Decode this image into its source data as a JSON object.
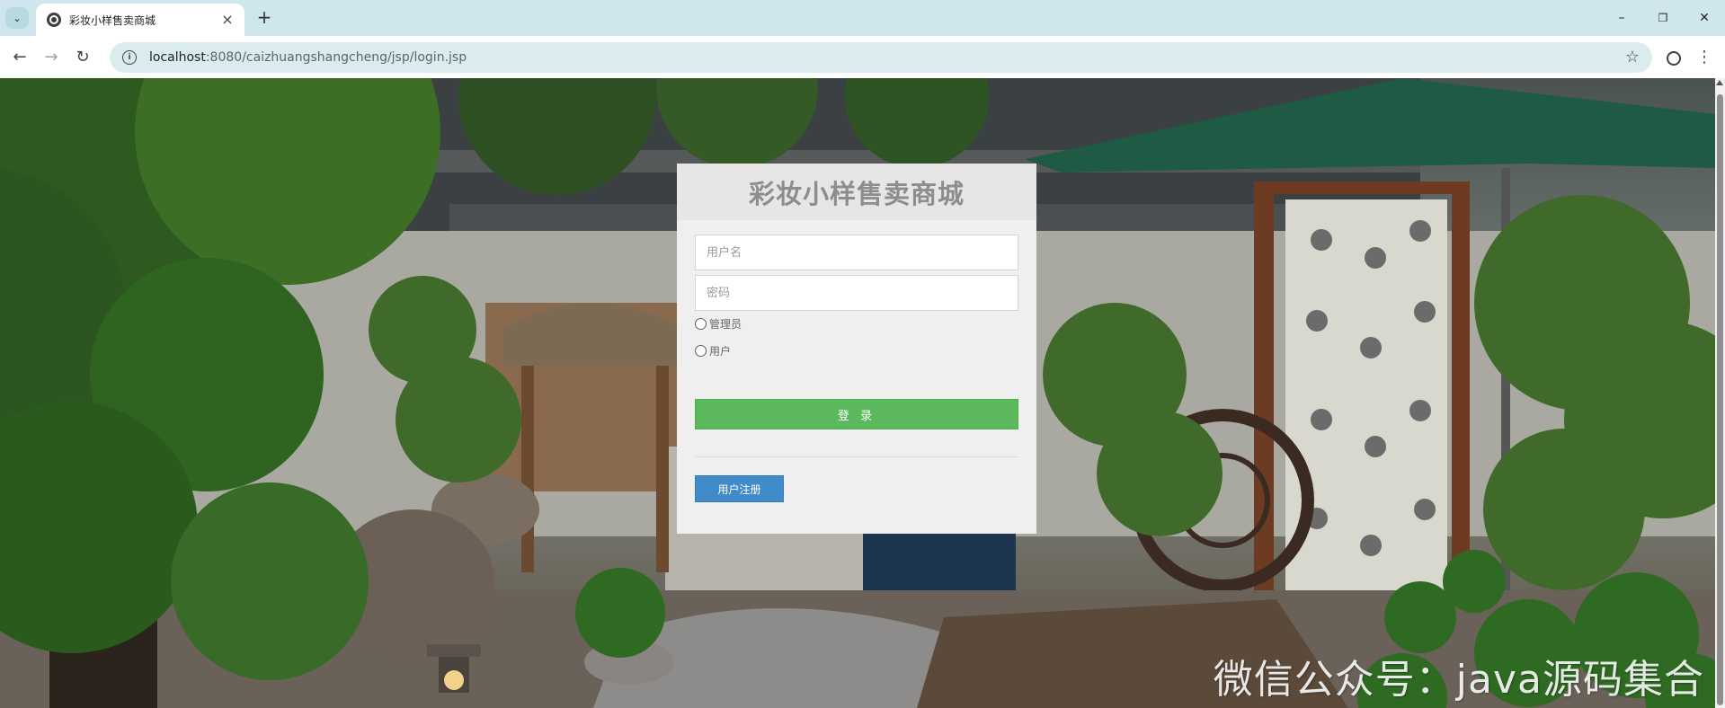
{
  "browser": {
    "tab_title": "彩妆小样售卖商城",
    "tab_close": "×",
    "new_tab": "+",
    "url_host": "localhost",
    "url_rest": ":8080/caizhuangshangcheng/jsp/login.jsp",
    "window_controls": {
      "minimize": "–",
      "restore": "❐",
      "close": "✕"
    },
    "nav": {
      "back": "←",
      "forward": "→",
      "reload": "↻"
    },
    "menu": "⋮",
    "bookmark": "☆",
    "tab_dropdown": "⌄"
  },
  "login": {
    "title": "彩妆小样售卖商城",
    "username_placeholder": "用户名",
    "password_placeholder": "密码",
    "roles": [
      {
        "label": "管理员",
        "checked": false
      },
      {
        "label": "用户",
        "checked": false
      }
    ],
    "login_button": "登 录",
    "register_button": "用户注册"
  },
  "watermark": "微信公众号：java源码集合",
  "icons": {
    "tab_menu": "chevron-down-icon",
    "favicon": "globe-icon",
    "site_info": "info-icon",
    "profile": "profile-icon"
  },
  "colors": {
    "chrome_bg": "#cfe6ec",
    "omnibox_bg": "#dbecef",
    "login_btn": "#5cb85c",
    "register_btn": "#428bca",
    "panel_bg": "#efefef",
    "title_color": "#8d8d8d"
  }
}
